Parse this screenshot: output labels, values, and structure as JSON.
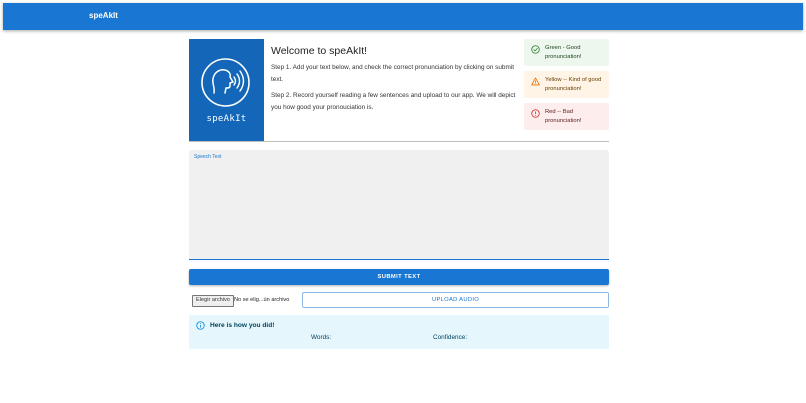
{
  "app": {
    "brand": "speAkIt"
  },
  "logo": {
    "text": "speAkIt"
  },
  "intro": {
    "title": "Welcome to speAkIt!",
    "step1": "Step 1. Add your text below, and check the correct pronunciation by clicking on submit text.",
    "step2": "Step 2. Record yourself reading a few sentences and upload to our app. We will depict you how good your pronouciation is."
  },
  "legend": {
    "green": {
      "text": "Green - Good pronunciation!",
      "color": "#2e7d32",
      "icon": "check-circle-icon"
    },
    "yellow": {
      "text": "Yellow -- Kind of good pronunciation!",
      "color": "#ed6c02",
      "icon": "warning-icon"
    },
    "red": {
      "text": "Red -- Bad pronunciation!",
      "color": "#d32f2f",
      "icon": "error-icon"
    }
  },
  "speech": {
    "label": "Speech Text",
    "value": ""
  },
  "actions": {
    "submit_label": "SUBMIT TEXT",
    "file_button": "Elegir archivo",
    "file_status": "No se elig...ún archivo",
    "upload_label": "UPLOAD AUDIO"
  },
  "result": {
    "title": "Here is how you did!",
    "words_label": "Words:",
    "confidence_label": "Confidence:"
  },
  "colors": {
    "primary": "#1976d2",
    "info_bg": "#e5f6fd"
  }
}
